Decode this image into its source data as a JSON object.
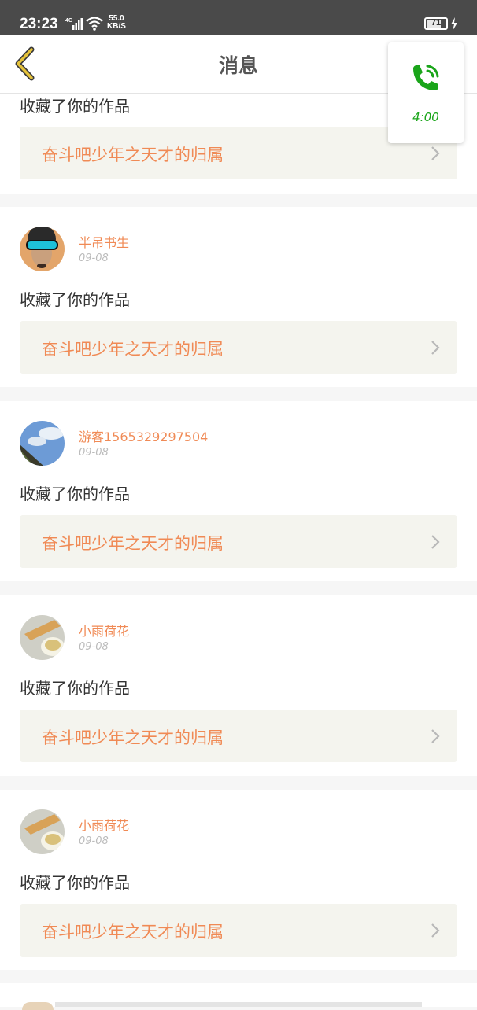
{
  "status_bar": {
    "time": "23:23",
    "network": "4G",
    "speed_value": "55.0",
    "speed_unit": "KB/S",
    "battery": "71"
  },
  "header": {
    "title": "消息"
  },
  "call_widget": {
    "duration": "4:00"
  },
  "feed": {
    "first_partial": {
      "action": "收藏了你的作品",
      "work_title": "奋斗吧少年之天才的归属"
    },
    "items": [
      {
        "user": "半吊书生",
        "date": "09-08",
        "action": "收藏了你的作品",
        "work_title": "奋斗吧少年之天才的归属"
      },
      {
        "user": "游客1565329297504",
        "date": "09-08",
        "action": "收藏了你的作品",
        "work_title": "奋斗吧少年之天才的归属"
      },
      {
        "user": "小雨荷花",
        "date": "09-08",
        "action": "收藏了你的作品",
        "work_title": "奋斗吧少年之天才的归属"
      },
      {
        "user": "小雨荷花",
        "date": "09-08",
        "action": "收藏了你的作品",
        "work_title": "奋斗吧少年之天才的归属"
      }
    ]
  },
  "icons": {
    "back": "chevron-left-icon",
    "call": "phone-icon",
    "row_arrow": "chevron-right-icon"
  },
  "colors": {
    "accent_orange": "#f08a55",
    "call_green": "#1aa51a",
    "back_yellow": "#e6c33a",
    "work_background": "#f4f4ee"
  }
}
